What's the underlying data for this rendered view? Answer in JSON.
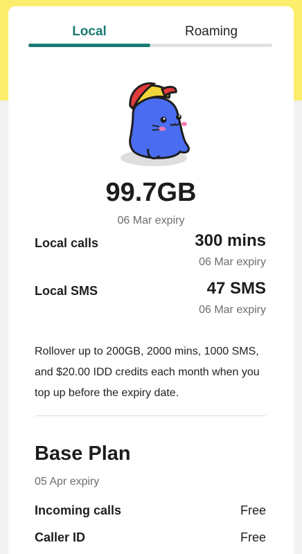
{
  "tabs": [
    {
      "label": "Local",
      "active": true
    },
    {
      "label": "Roaming",
      "active": false
    }
  ],
  "accent_color": "#1a7a72",
  "header_color": "#fbee6c",
  "mascot": {
    "icon": "seal-mascot-with-cap-icon"
  },
  "data": {
    "amount": "99.7GB",
    "expiry": "06 Mar expiry"
  },
  "allowances": [
    {
      "label": "Local calls",
      "value": "300 mins",
      "expiry": "06 Mar expiry"
    },
    {
      "label": "Local SMS",
      "value": "47 SMS",
      "expiry": "06 Mar expiry"
    }
  ],
  "rollover_text": "Rollover up to 200GB, 2000 mins, 1000 SMS, and $20.00 IDD credits each month when you top up before the expiry date.",
  "base_plan": {
    "title": "Base Plan",
    "expiry": "05 Apr expiry",
    "features": [
      {
        "label": "Incoming calls",
        "value": "Free"
      },
      {
        "label": "Caller ID",
        "value": "Free"
      }
    ]
  }
}
